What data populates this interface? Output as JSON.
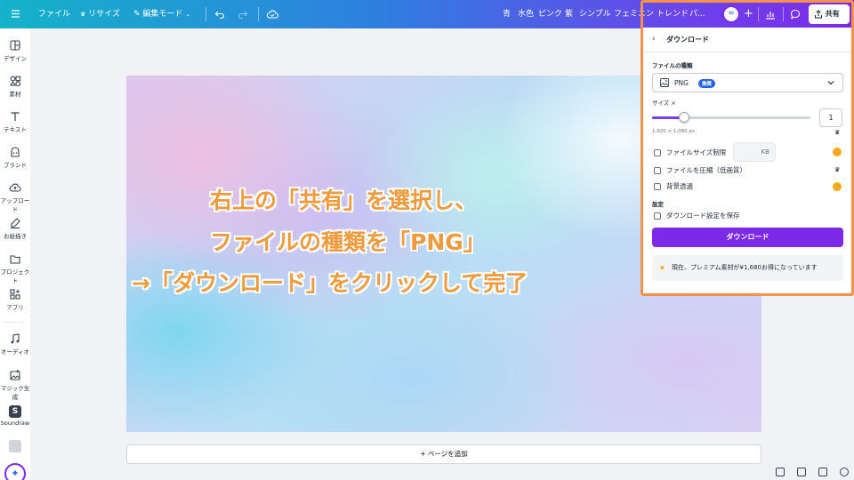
{
  "topbar": {
    "menu_icon": "hamburger-icon",
    "file_label": "ファイル",
    "resize_label": "リサイズ",
    "edit_mode_label": "編集モード",
    "tags": [
      "青",
      "水色",
      "ピンク",
      "紫",
      "シンプル",
      "フェミニン",
      "トレンド",
      "パ..."
    ],
    "share_label": "共有"
  },
  "sidebar": {
    "items": [
      {
        "label": "デザイン",
        "icon": "layout-icon"
      },
      {
        "label": "素材",
        "icon": "shapes-icon"
      },
      {
        "label": "テキスト",
        "icon": "text-icon"
      },
      {
        "label": "ブランド",
        "icon": "brand-icon"
      },
      {
        "label": "アップロード",
        "icon": "cloud-upload-icon"
      },
      {
        "label": "お絵描き",
        "icon": "pen-icon"
      },
      {
        "label": "プロジェクト",
        "icon": "folder-icon"
      },
      {
        "label": "アプリ",
        "icon": "apps-icon"
      },
      {
        "label": "オーディオ",
        "icon": "music-icon"
      },
      {
        "label": "マジック生成",
        "icon": "magic-image-icon"
      },
      {
        "label": "Soundraw",
        "icon": "soundraw-icon"
      }
    ]
  },
  "canvas": {
    "add_page_label": "+ ページを追加"
  },
  "instruction": {
    "line1": "右上の「共有」を選択し、",
    "line2": "ファイルの種類を「PNG」",
    "line3": "→「ダウンロード」をクリックして完了"
  },
  "panel": {
    "title": "ダウンロード",
    "file_type_label": "ファイルの種類",
    "file_type_value": "PNG",
    "recommended_badge": "推奨",
    "size_label": "サイズ ×",
    "size_value": "1",
    "size_fraction": 0.2,
    "dimensions": "1,920 × 1,080 px",
    "option_filesize_limit": "ファイルサイズ制限",
    "kb_unit": "KB",
    "option_compress": "ファイルを圧縮（低画質）",
    "option_transparent": "背景透過",
    "settings_label": "設定",
    "option_save_settings": "ダウンロード設定を保存",
    "download_button": "ダウンロード",
    "promo_text": "現在、プレミアム素材が¥1,680お得になっています"
  },
  "colors": {
    "brand_purple": "#7d2ae8",
    "highlight_orange": "#f4924a",
    "instruction_text": "#ef9a3d",
    "pro_badge": "#f6a91c"
  }
}
